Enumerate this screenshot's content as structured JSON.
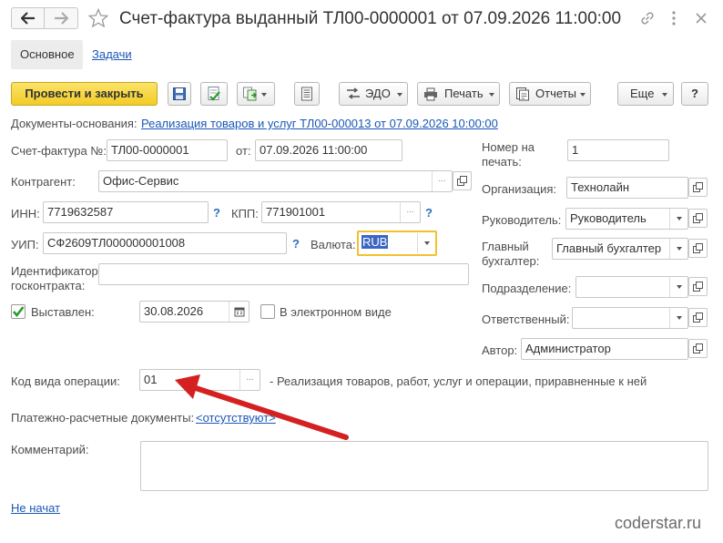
{
  "header": {
    "title": "Счет-фактура выданный ТЛ00-0000001 от 07.09.2026 11:00:00",
    "back_icon": "arrow-left-icon",
    "forward_icon": "arrow-right-icon"
  },
  "tabs": [
    {
      "label": "Основное",
      "active": true
    },
    {
      "label": "Задачи",
      "active": false
    }
  ],
  "toolbar": {
    "post_close": "Провести и закрыть",
    "edo": "ЭДО",
    "print": "Печать",
    "reports": "Отчеты",
    "more": "Еще",
    "help": "?"
  },
  "basis": {
    "label": "Документы-основания:",
    "link": "Реализация товаров и услуг ТЛ00-000013 от 07.09.2026 10:00:00"
  },
  "form": {
    "invoice_no_label": "Счет-фактура №:",
    "invoice_no": "ТЛ00-0000001",
    "from_label": "от:",
    "from_date": "07.09.2026 11:00:00",
    "counterparty_label": "Контрагент:",
    "counterparty": "Офис-Сервис",
    "inn_label": "ИНН:",
    "inn": "7719632587",
    "kpp_label": "КПП:",
    "kpp": "771901001",
    "uip_label": "УИП:",
    "uip": "СФ2609ТЛ000000001008",
    "currency_label": "Валюта:",
    "currency": "RUB",
    "gov_contract_label": "Идентификатор госконтракта:",
    "gov_contract": "",
    "issued_label": "Выставлен:",
    "issued_date": "30.08.2026",
    "electronic_label": "В электронном виде",
    "op_code_label": "Код вида операции:",
    "op_code": "01",
    "op_code_desc": "- Реализация товаров, работ, услуг и операции, приравненные к ней",
    "payment_docs_label": "Платежно-расчетные документы:",
    "payment_docs_link": "<отсутствуют>",
    "comment_label": "Комментарий:",
    "comment": "",
    "status_link": "Не начат"
  },
  "right": {
    "print_no_label": "Номер на печать:",
    "print_no": "1",
    "org_label": "Организация:",
    "org": "Технолайн",
    "head_label": "Руководитель:",
    "head": "Руководитель",
    "chief_acc_label": "Главный бухгалтер:",
    "chief_acc": "Главный бухгалтер",
    "dept_label": "Подразделение:",
    "dept": "",
    "responsible_label": "Ответственный:",
    "responsible": "",
    "author_label": "Автор:",
    "author": "Администратор"
  },
  "watermark": "coderstar.ru",
  "colors": {
    "accent_button": "#f5d12d",
    "link": "#1a57b8",
    "arrow": "#d42020",
    "focus_border": "#f2c12e"
  }
}
